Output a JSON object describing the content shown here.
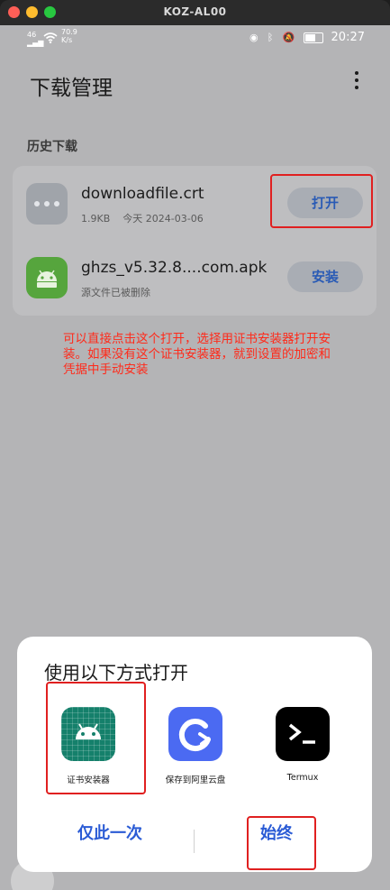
{
  "window": {
    "title": "KOZ-AL00"
  },
  "status_bar": {
    "signal": "46",
    "speed_value": "70.9",
    "speed_unit": "K/s",
    "time": "20:27"
  },
  "page": {
    "title": "下载管理",
    "section_label": "历史下载"
  },
  "downloads": [
    {
      "name": "downloadfile.crt",
      "size": "1.9KB",
      "date": "今天 2024-03-06",
      "action": "打开",
      "icon": "more-dots-icon"
    },
    {
      "name": "ghzs_v5.32.8....com.apk",
      "status": "源文件已被删除",
      "action": "安装",
      "icon": "android-icon"
    }
  ],
  "annotation": "可以直接点击这个打开，选择用证书安装器打开安装。如果没有这个证书安装器，就到设置的加密和凭据中手动安装",
  "sheet": {
    "title": "使用以下方式打开",
    "options": [
      {
        "label": "证书安装器",
        "icon": "android-icon"
      },
      {
        "label": "保存到阿里云盘",
        "icon": "aliyun-drive-icon"
      },
      {
        "label": "Termux",
        "icon": "terminal-icon"
      }
    ],
    "just_once": "仅此一次",
    "always": "始终"
  },
  "colors": {
    "accent": "#2a5bd5",
    "annotation": "#ff2a1a",
    "apk_green": "#56a53d",
    "installer_teal": "#15806b"
  }
}
